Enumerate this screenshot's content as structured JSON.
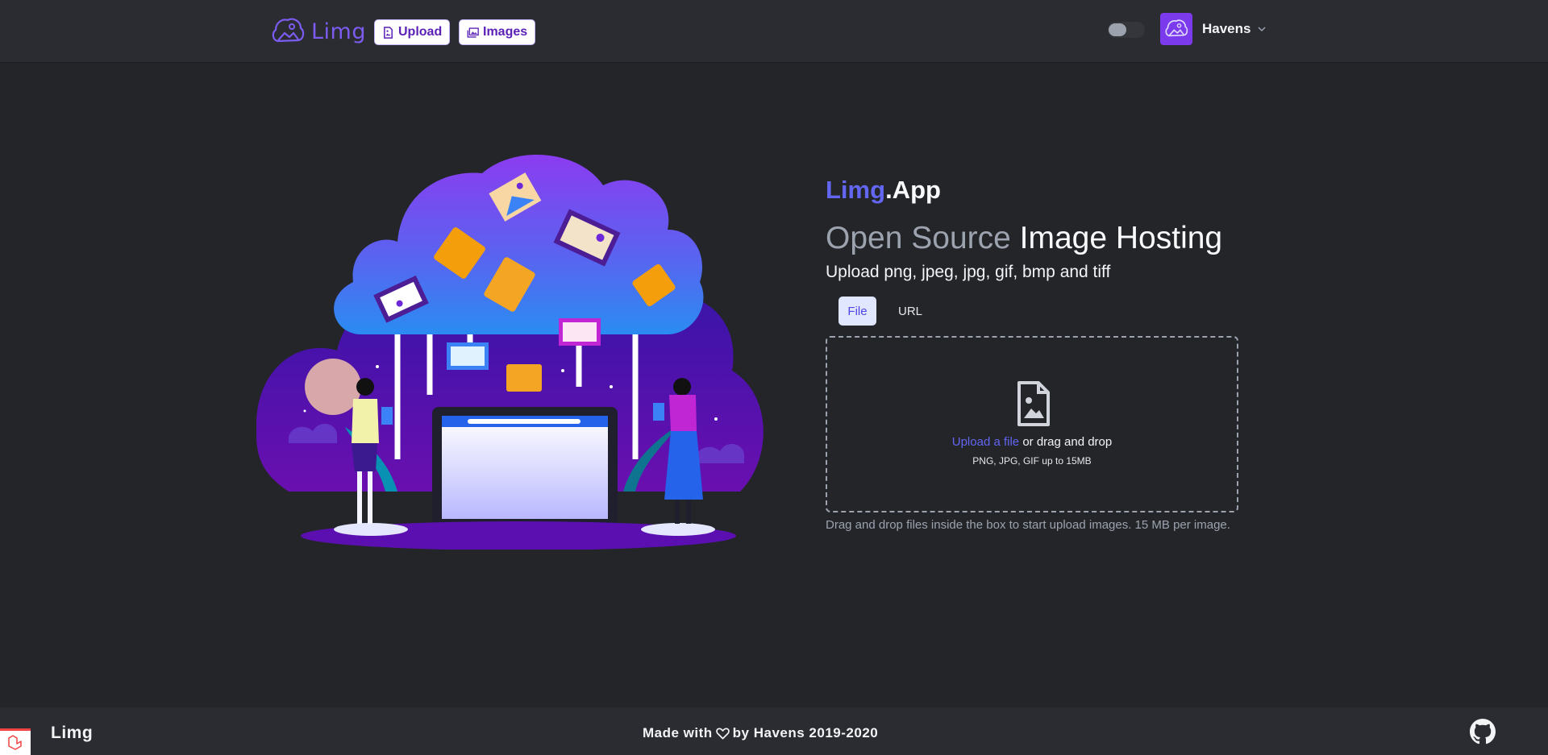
{
  "header": {
    "logo_text": "Limg",
    "nav": {
      "upload_label": "Upload",
      "images_label": "Images"
    },
    "user": {
      "name": "Havens"
    }
  },
  "hero": {
    "brand_part1": "Limg",
    "brand_part2": ".App",
    "headline_muted": "Open Source",
    "headline_strong": "Image Hosting",
    "subline": "Upload png, jpeg, jpg, gif, bmp and tiff",
    "tabs": [
      {
        "label": "File",
        "active": true
      },
      {
        "label": "URL",
        "active": false
      }
    ],
    "dropzone": {
      "link_text": "Upload a file",
      "rest_text": "or drag and drop",
      "hint": "PNG, JPG, GIF up to 15MB"
    },
    "help_text": "Drag and drop files inside the box to start upload images. 15 MB per image."
  },
  "footer": {
    "brand": "Limg",
    "made_prefix": "Made with",
    "made_suffix": "by Havens 2019-2020"
  },
  "colors": {
    "accent": "#6366f1",
    "brand_purple": "#7c3aed",
    "background": "#232529",
    "header_bg": "#2a2c31"
  },
  "icons": {
    "logo": "cloud-image-icon",
    "upload": "file-image-icon",
    "images": "images-icon",
    "dropzone": "file-image-icon",
    "heart": "heart-icon",
    "github": "github-icon"
  }
}
